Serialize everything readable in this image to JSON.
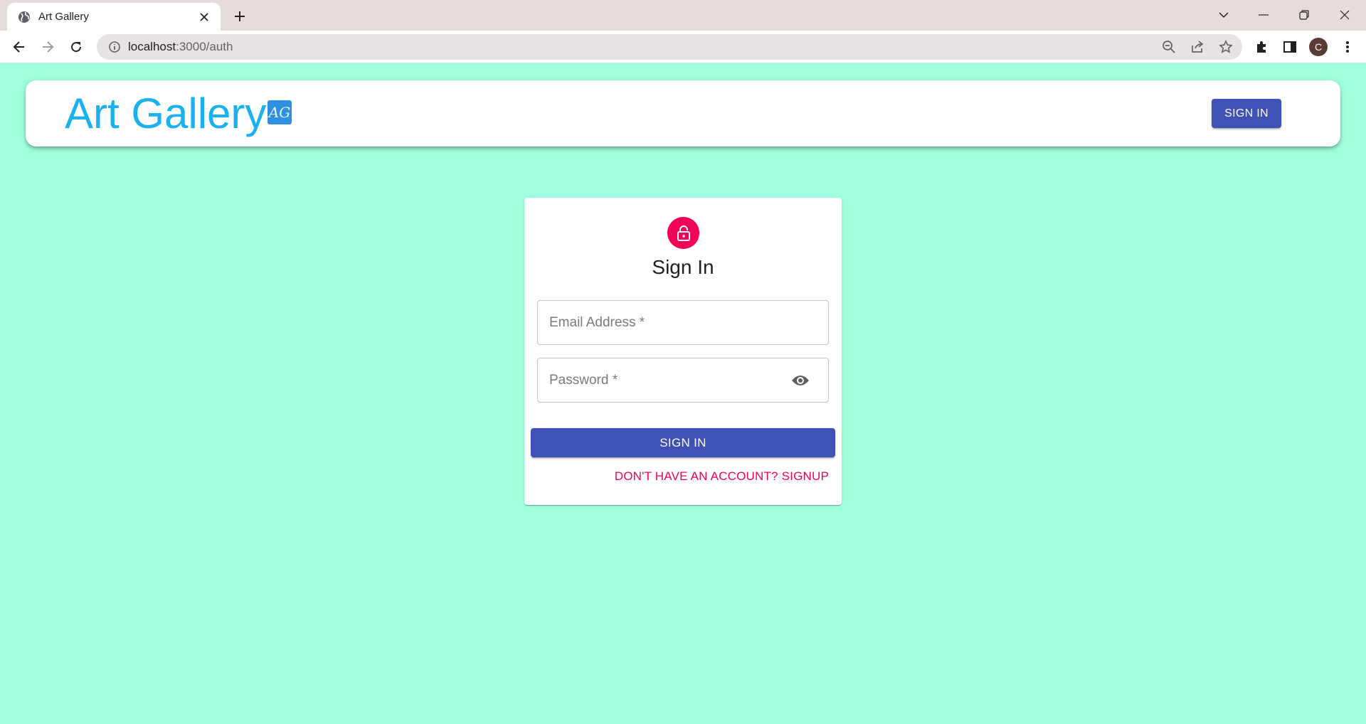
{
  "browser": {
    "tab_title": "Art Gallery",
    "url_host": "localhost",
    "url_rest": ":3000/auth",
    "profile_initial": "C"
  },
  "appbar": {
    "brand": "Art Gallery",
    "logo_text": "AG",
    "signin_label": "SIGN IN"
  },
  "auth": {
    "title": "Sign In",
    "email_label": "Email Address *",
    "password_label": "Password *",
    "submit_label": "SIGN IN",
    "switch_label": "DON'T HAVE AN ACCOUNT? SIGNUP"
  },
  "colors": {
    "page_bg": "#a0ffdc",
    "primary": "#3f51b5",
    "secondary": "#f50057",
    "brand": "#1ab1f0"
  },
  "icons": [
    "globe-icon",
    "close-icon",
    "plus-icon",
    "back-icon",
    "forward-icon",
    "reload-icon",
    "info-icon",
    "zoom-out-icon",
    "share-icon",
    "star-icon",
    "extensions-icon",
    "side-panel-icon",
    "menu-icon",
    "lock-icon",
    "eye-icon"
  ]
}
